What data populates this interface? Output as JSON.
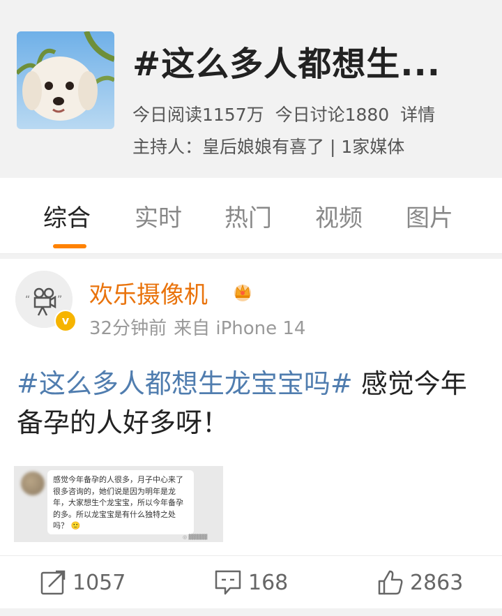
{
  "topic": {
    "title": "#这么多人都想生...",
    "reads": "今日阅读1157万",
    "discussions": "今日讨论1880",
    "details_link": "详情",
    "host_label": "主持人：",
    "host_name": "皇后娘娘有喜了",
    "media": "| 1家媒体"
  },
  "tabs": [
    {
      "label": "综合",
      "active": true
    },
    {
      "label": "实时"
    },
    {
      "label": "热门"
    },
    {
      "label": "视频"
    },
    {
      "label": "图片"
    }
  ],
  "post": {
    "username": "欢乐摄像机",
    "time": "32分钟前",
    "source": "来自 iPhone 14",
    "hashtag": "#这么多人都想生龙宝宝吗#",
    "text": " 感觉今年备孕的人好多呀！",
    "image_text": "感觉今年备孕的人很多，月子中心来了很多咨询的，她们说是因为明年是龙年，大家想生个龙宝宝，所以今年备孕的多。所以龙宝宝是有什么独特之处吗？",
    "image_emoji": "🙂",
    "verify_mark": "v"
  },
  "actions": {
    "reposts": "1057",
    "comments": "168",
    "likes": "2863"
  },
  "colors": {
    "accent": "#ff8200",
    "username": "#e9730c",
    "hashtag": "#507daf",
    "header_bg": "#f2f2f2"
  },
  "icons": [
    "dog-photo-cover",
    "camera-avatar-icon",
    "verified-badge-icon",
    "crown-icon",
    "repost-icon",
    "comment-icon",
    "like-icon"
  ]
}
